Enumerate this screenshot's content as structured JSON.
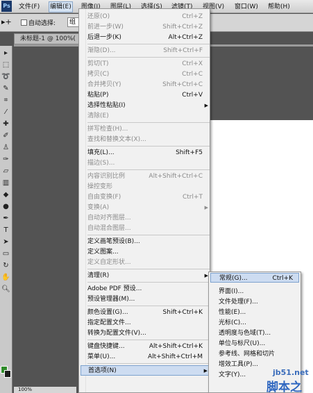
{
  "app": {
    "logo_text": "Ps"
  },
  "menubar": {
    "items": [
      "文件(F)",
      "编辑(E)",
      "图像(I)",
      "图层(L)",
      "选择(S)",
      "滤镜(T)",
      "视图(V)",
      "窗口(W)",
      "帮助(H)"
    ],
    "active_index": 1
  },
  "options_bar": {
    "tool_glyph": "▸+",
    "auto_select_label": "自动选择:",
    "select_value": "组"
  },
  "document": {
    "tab_title": "未标题-1 @ 100%(",
    "zoom": "100%"
  },
  "edit_menu": {
    "items": [
      {
        "label": "还原(O)",
        "shortcut": "Ctrl+Z",
        "disabled": true
      },
      {
        "label": "前进一步(W)",
        "shortcut": "Shift+Ctrl+Z",
        "disabled": true
      },
      {
        "label": "后退一步(K)",
        "shortcut": "Alt+Ctrl+Z",
        "disabled": false
      },
      {
        "label": "渐隐(D)...",
        "shortcut": "Shift+Ctrl+F",
        "disabled": true
      },
      {
        "label": "剪切(T)",
        "shortcut": "Ctrl+X",
        "disabled": true
      },
      {
        "label": "拷贝(C)",
        "shortcut": "Ctrl+C",
        "disabled": true
      },
      {
        "label": "合并拷贝(Y)",
        "shortcut": "Shift+Ctrl+C",
        "disabled": true
      },
      {
        "label": "粘贴(P)",
        "shortcut": "Ctrl+V",
        "disabled": false
      },
      {
        "label": "选择性粘贴(I)",
        "shortcut": "",
        "disabled": false,
        "submenu": true
      },
      {
        "label": "清除(E)",
        "shortcut": "",
        "disabled": true
      },
      {
        "label": "拼写检查(H)...",
        "shortcut": "",
        "disabled": true
      },
      {
        "label": "查找和替换文本(X)...",
        "shortcut": "",
        "disabled": true
      },
      {
        "label": "填充(L)...",
        "shortcut": "Shift+F5",
        "disabled": false
      },
      {
        "label": "描边(S)...",
        "shortcut": "",
        "disabled": true
      },
      {
        "label": "内容识别比例",
        "shortcut": "Alt+Shift+Ctrl+C",
        "disabled": true
      },
      {
        "label": "操控变形",
        "shortcut": "",
        "disabled": true
      },
      {
        "label": "自由变换(F)",
        "shortcut": "Ctrl+T",
        "disabled": true
      },
      {
        "label": "变换(A)",
        "shortcut": "",
        "disabled": true,
        "submenu": true
      },
      {
        "label": "自动对齐图层...",
        "shortcut": "",
        "disabled": true
      },
      {
        "label": "自动混合图层...",
        "shortcut": "",
        "disabled": true
      },
      {
        "label": "定义画笔预设(B)...",
        "shortcut": "",
        "disabled": false
      },
      {
        "label": "定义图案...",
        "shortcut": "",
        "disabled": false
      },
      {
        "label": "定义自定形状...",
        "shortcut": "",
        "disabled": true
      },
      {
        "label": "清理(R)",
        "shortcut": "",
        "disabled": false,
        "submenu": true
      },
      {
        "label": "Adobe PDF 预设...",
        "shortcut": "",
        "disabled": false
      },
      {
        "label": "预设管理器(M)...",
        "shortcut": "",
        "disabled": false
      },
      {
        "label": "颜色设置(G)...",
        "shortcut": "Shift+Ctrl+K",
        "disabled": false
      },
      {
        "label": "指定配置文件...",
        "shortcut": "",
        "disabled": false
      },
      {
        "label": "转换为配置文件(V)...",
        "shortcut": "",
        "disabled": false
      },
      {
        "label": "键盘快捷键...",
        "shortcut": "Alt+Shift+Ctrl+K",
        "disabled": false
      },
      {
        "label": "菜单(U)...",
        "shortcut": "Alt+Shift+Ctrl+M",
        "disabled": false
      },
      {
        "label": "首选项(N)",
        "shortcut": "",
        "disabled": false,
        "submenu": true,
        "highlighted": true
      }
    ]
  },
  "preferences_submenu": {
    "items": [
      {
        "label": "常规(G)...",
        "shortcut": "Ctrl+K",
        "highlighted": true
      },
      {
        "label": "界面(I)...",
        "shortcut": ""
      },
      {
        "label": "文件处理(F)...",
        "shortcut": ""
      },
      {
        "label": "性能(E)...",
        "shortcut": ""
      },
      {
        "label": "光标(C)...",
        "shortcut": ""
      },
      {
        "label": "透明度与色域(T)...",
        "shortcut": ""
      },
      {
        "label": "单位与标尺(U)...",
        "shortcut": ""
      },
      {
        "label": "参考线、网格和切片",
        "shortcut": ""
      },
      {
        "label": "增效工具(P)...",
        "shortcut": ""
      },
      {
        "label": "文字(Y)...",
        "shortcut": ""
      }
    ]
  },
  "watermark": {
    "line1": "jb51.net",
    "line2": "脚本之家"
  },
  "colors": {
    "menu_bg": "#f1f1f1",
    "highlight": "#cddcf1",
    "foreground": "#2f8a2a",
    "background": "#1c1c1c"
  }
}
